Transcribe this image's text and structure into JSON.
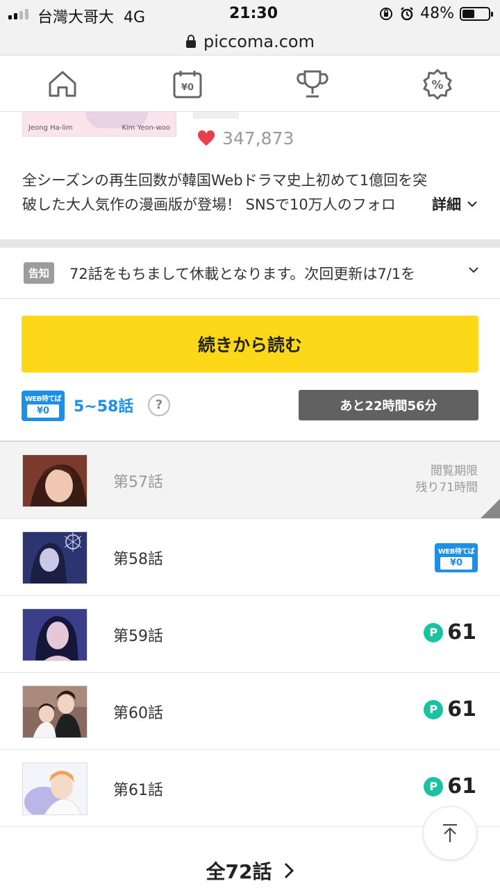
{
  "status_bar": {
    "carrier": "台灣大哥大",
    "network": "4G",
    "time": "21:30",
    "battery_percent": "48%",
    "battery_level": 0.48
  },
  "browser": {
    "url": "piccoma.com"
  },
  "nav": {
    "items": [
      {
        "name": "home",
        "icon": "house-icon"
      },
      {
        "name": "free-calendar",
        "icon": "calendar-yen-icon",
        "icon_text": "¥0"
      },
      {
        "name": "ranking",
        "icon": "trophy-icon"
      },
      {
        "name": "sale",
        "icon": "percent-badge-icon",
        "icon_text": "%"
      }
    ]
  },
  "work": {
    "cover_author_left": "Jeong Ha-lim",
    "cover_author_right": "Kim Yeon-woo",
    "likes": "347,873",
    "description_line1": "全シーズンの再生回数が韓国Webドラマ史上初めて1億回を突",
    "description_line2": "破した大人気作の漫画版が登場！ SNSで10万人のフォロ",
    "detail_label": "詳細"
  },
  "notice": {
    "badge": "告知",
    "text": "72話をもちまして休載となります。次回更新は7/1を"
  },
  "continue_button": "続きから読む",
  "wait_free": {
    "badge_top": "WEB待てば",
    "badge_bottom": "¥0",
    "range": "5~58話",
    "help": "?",
    "timer": "あと22時間56分"
  },
  "episodes": [
    {
      "title": "第57話",
      "status": "rental",
      "limit_line1": "閲覧期限",
      "limit_line2": "残り71時間"
    },
    {
      "title": "第58話",
      "status": "wait-free",
      "badge_top": "WEB待てば",
      "badge_bottom": "¥0"
    },
    {
      "title": "第59話",
      "status": "points",
      "coin": "P",
      "price": "61"
    },
    {
      "title": "第60話",
      "status": "points",
      "coin": "P",
      "price": "61"
    },
    {
      "title": "第61話",
      "status": "points",
      "coin": "P",
      "price": "61"
    }
  ],
  "all_episodes_link": "全72話",
  "colors": {
    "accent_yellow": "#fcd818",
    "wait_blue": "#1e8fe6",
    "point_green": "#18c3a2",
    "heart_red": "#e8404a"
  }
}
